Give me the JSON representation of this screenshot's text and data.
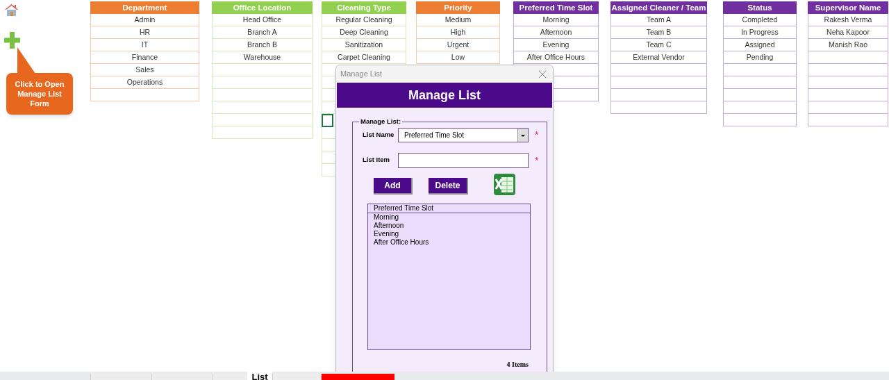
{
  "callout": {
    "text": "Click to Open Manage List Form"
  },
  "tables": [
    {
      "header": "Department",
      "color": "#ed7d31",
      "rows": [
        "Admin",
        "HR",
        "IT",
        "Finance",
        "Sales",
        "Operations",
        ""
      ]
    },
    {
      "header": "Office Location",
      "color": "#92d050",
      "rows": [
        "Head Office",
        "Branch A",
        "Branch B",
        "Warehouse",
        "",
        "",
        "",
        "",
        "",
        ""
      ]
    },
    {
      "header": "Cleaning Type",
      "color": "#92d050",
      "rows": [
        "Regular Cleaning",
        "Deep Cleaning",
        "Sanitization",
        "Carpet Cleaning",
        "",
        "",
        "",
        "",
        "",
        "",
        "",
        "",
        ""
      ]
    },
    {
      "header": "Priority",
      "color": "#ed7d31",
      "rows": [
        "Medium",
        "High",
        "Urgent",
        "Low"
      ]
    },
    {
      "header": "Preferred Time Slot",
      "color": "#7030a0",
      "rows": [
        "Morning",
        "Afternoon",
        "Evening",
        "After Office Hours",
        "",
        "",
        ""
      ]
    },
    {
      "header": "Assigned Cleaner / Team",
      "color": "#7030a0",
      "rows": [
        "Team A",
        "Team B",
        "Team C",
        "External Vendor",
        "",
        "",
        "",
        ""
      ]
    },
    {
      "header": "Status",
      "color": "#7030a0",
      "rows": [
        "Completed",
        "In Progress",
        "Assigned",
        "Pending",
        "",
        "",
        "",
        "",
        ""
      ]
    },
    {
      "header": "Supervisor Name",
      "color": "#7030a0",
      "rows": [
        "Rakesh Verma",
        "Neha Kapoor",
        "Manish Rao",
        "",
        "",
        "",
        "",
        "",
        ""
      ]
    }
  ],
  "dialog": {
    "title": "Manage List",
    "header": "Manage List",
    "group_label": "Manage List:",
    "list_name": {
      "label": "List Name",
      "value": "Preferred Time Slot",
      "required_mark": "*"
    },
    "list_item": {
      "label": "List Item",
      "required_mark": "*"
    },
    "buttons": [
      "Add",
      "Delete"
    ],
    "listbox": {
      "header": "Preferred Time Slot",
      "items": [
        "Morning",
        "Afternoon",
        "Evening",
        "After Office Hours"
      ]
    },
    "count": "4 Items"
  },
  "sheet_tabs": [
    {
      "selected": false,
      "color": "#ededed"
    },
    {
      "selected": false,
      "color": "#ededed"
    },
    {
      "selected": false,
      "color": "#ededed"
    },
    {
      "label": "List",
      "selected": true,
      "color": "#ffffff"
    },
    {
      "selected": false,
      "color": "#ededed"
    },
    {
      "selected": false,
      "color": "#ff0000"
    }
  ]
}
